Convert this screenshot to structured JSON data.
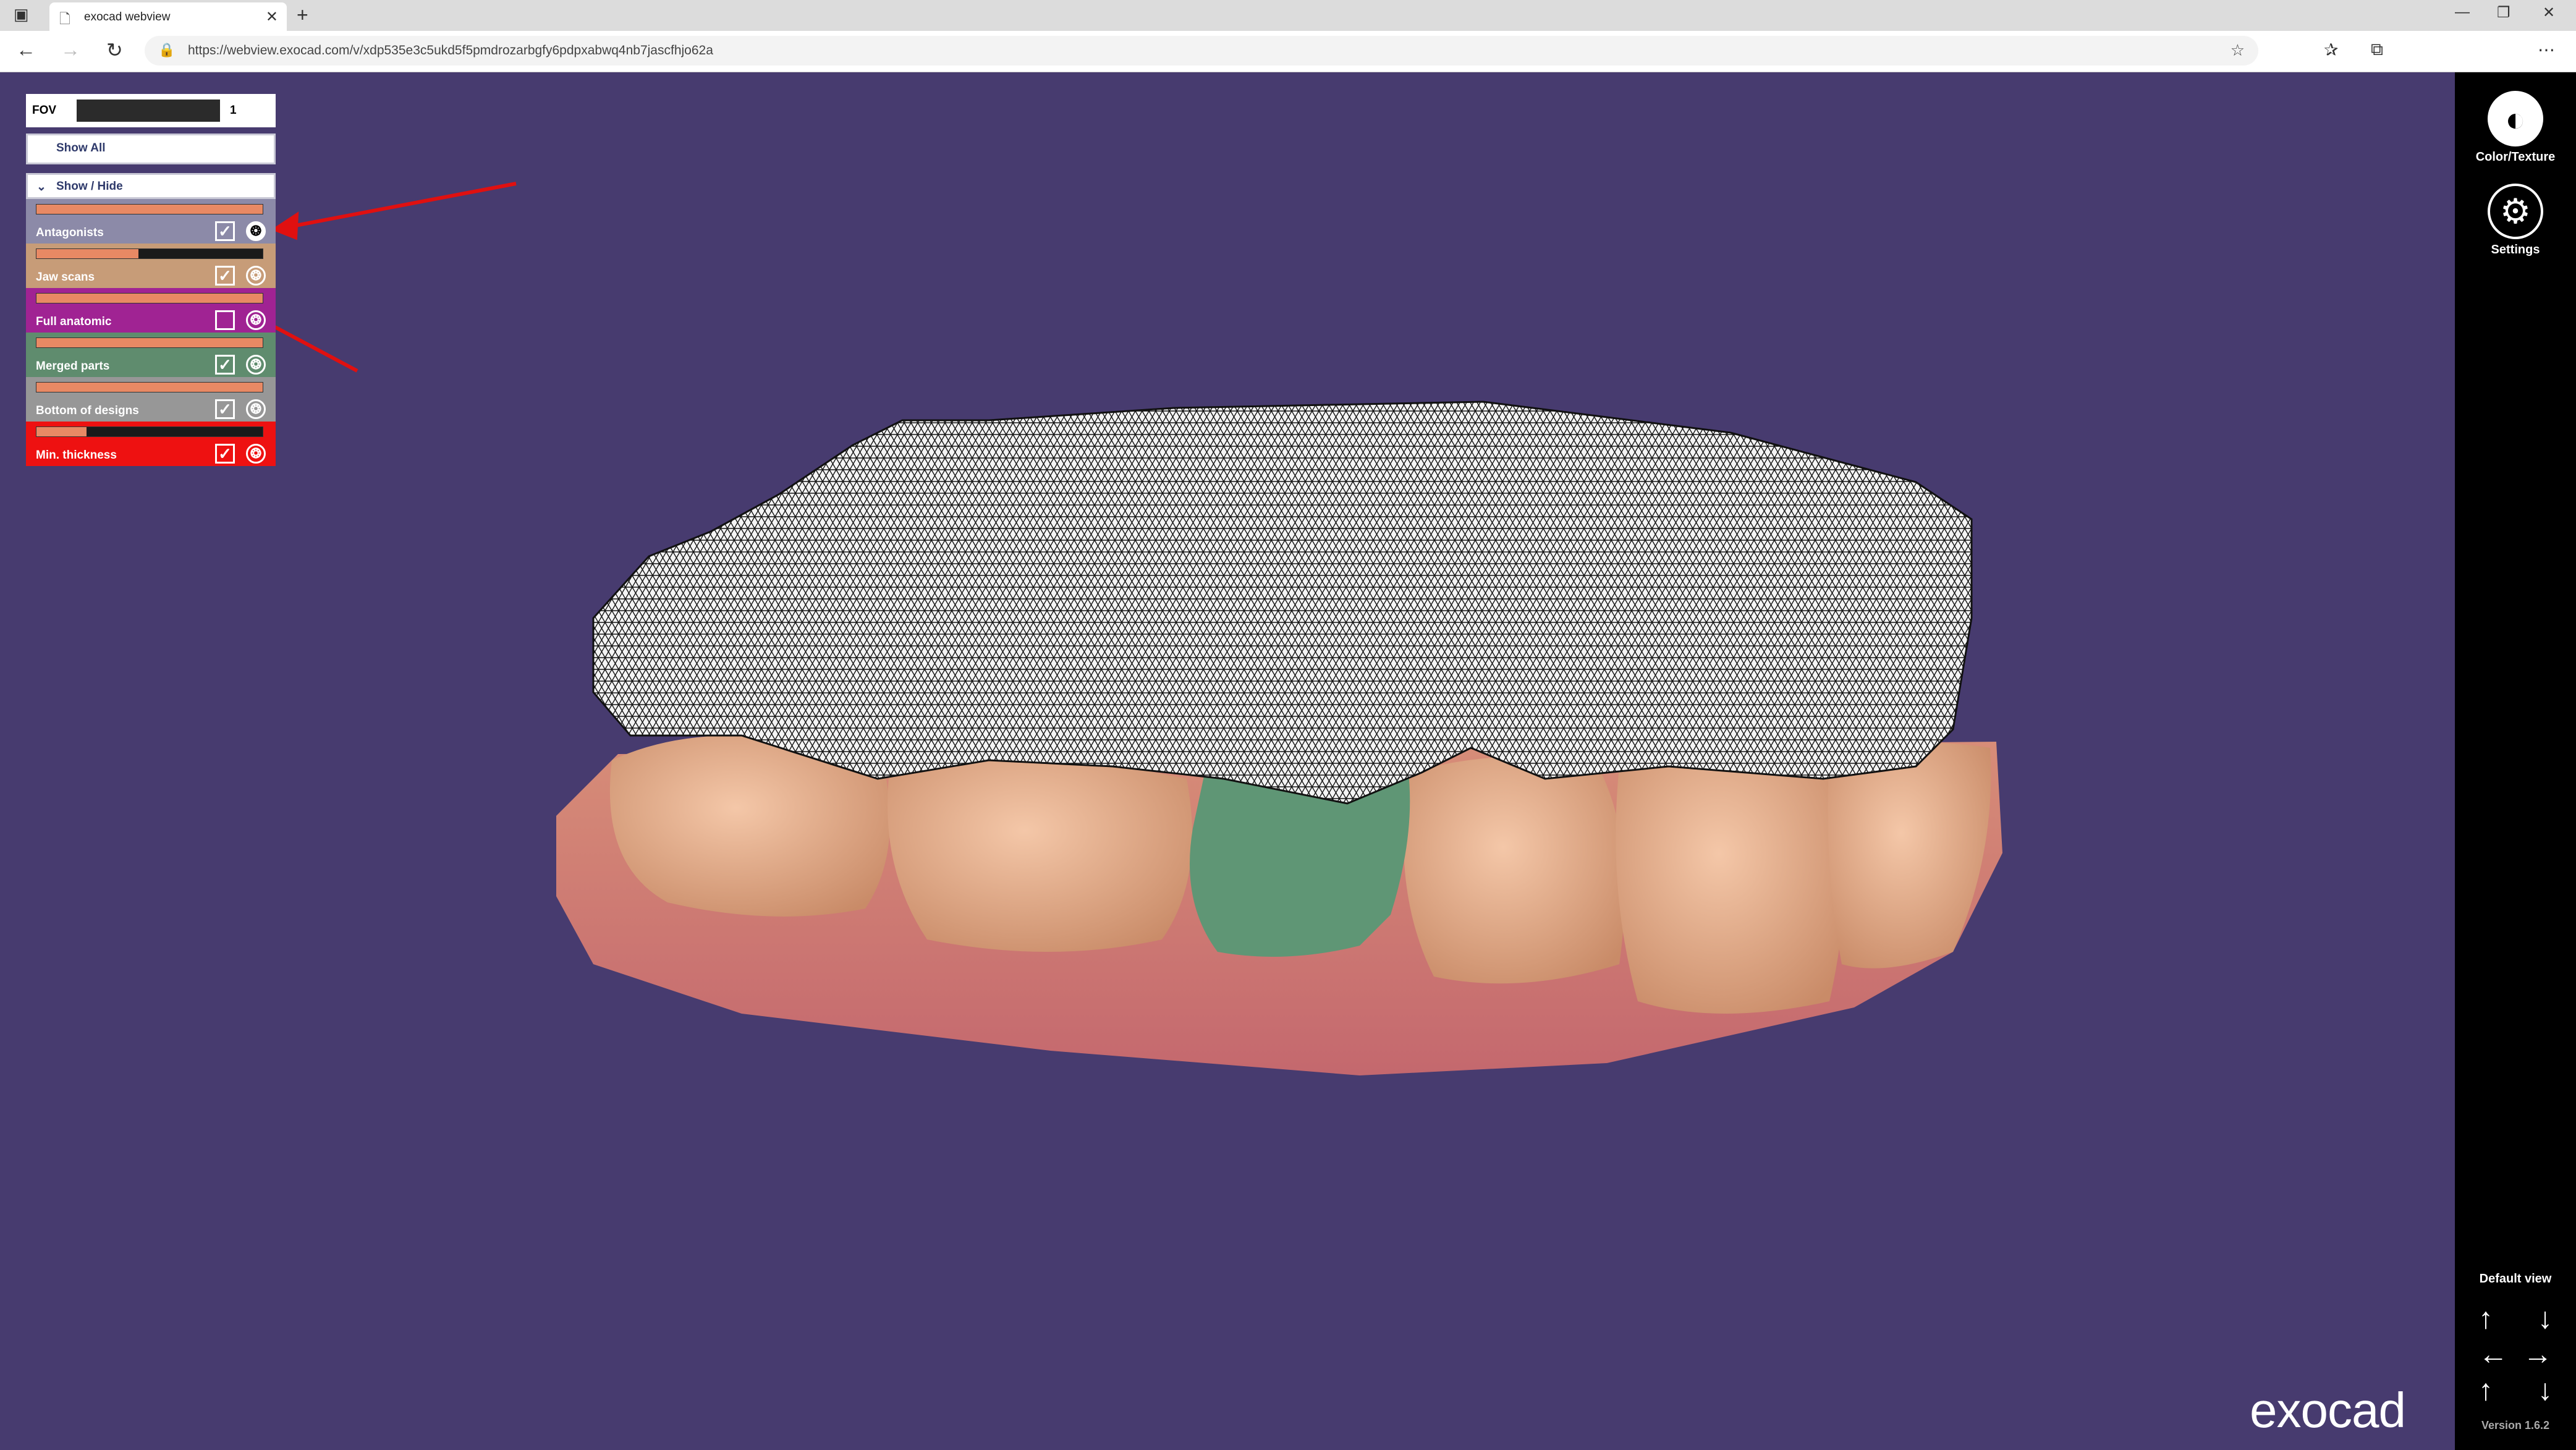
{
  "browser": {
    "tab_title": "exocad webview",
    "url": "https://webview.exocad.com/v/xdp535e3c5ukd5f5pmdrozarbgfy6pdpxabwq4nb7jascfhjo62a",
    "new_tab": "+",
    "close": "✕"
  },
  "panel": {
    "fov_label": "FOV",
    "fov_value": "1",
    "show_all": "Show All",
    "show_hide": "Show / Hide",
    "layers": [
      {
        "name": "Antagonists",
        "checked": "✓",
        "color": "#8c8aa8",
        "opacity": 1.0
      },
      {
        "name": "Jaw scans",
        "checked": "✓",
        "color": "#c79c78",
        "opacity": 0.45
      },
      {
        "name": "Full anatomic",
        "checked": "",
        "color": "#a02393",
        "opacity": 1.0
      },
      {
        "name": "Merged parts",
        "checked": "✓",
        "color": "#5f8c6e",
        "opacity": 1.0
      },
      {
        "name": "Bottom of designs",
        "checked": "✓",
        "color": "#979797",
        "opacity": 1.0
      },
      {
        "name": "Min. thickness",
        "checked": "✓",
        "color": "#ee1111",
        "opacity": 0.22
      }
    ]
  },
  "sidebar": {
    "color_texture": "Color/Texture",
    "settings": "Settings",
    "default_view": "Default view",
    "version": "Version 1.6.2"
  },
  "logo": "exocad"
}
